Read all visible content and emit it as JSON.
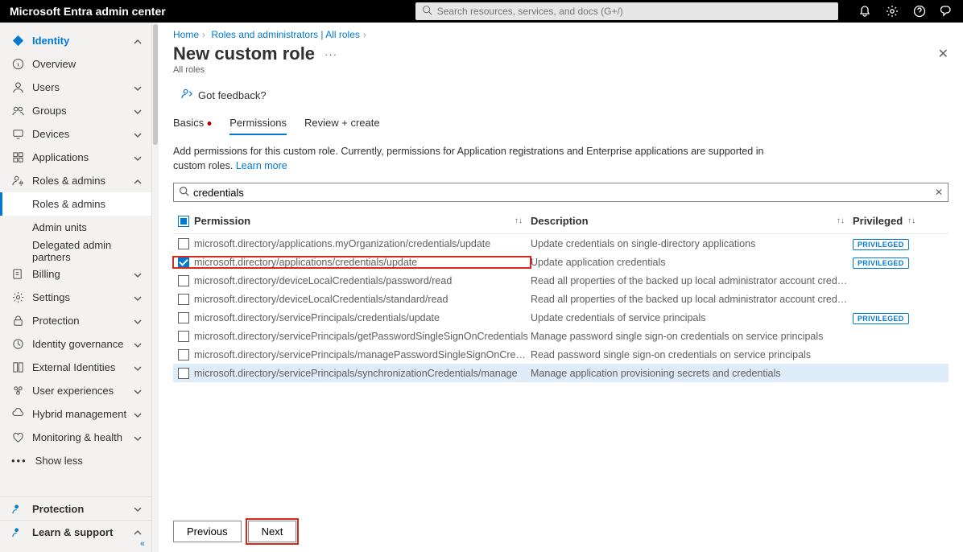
{
  "brand": "Microsoft Entra admin center",
  "search_placeholder": "Search resources, services, and docs (G+/)",
  "nav": {
    "identity": "Identity",
    "overview": "Overview",
    "users": "Users",
    "groups": "Groups",
    "devices": "Devices",
    "applications": "Applications",
    "roles_admins": "Roles & admins",
    "roles_admins_sub": "Roles & admins",
    "admin_units": "Admin units",
    "delegated": "Delegated admin partners",
    "billing": "Billing",
    "settings": "Settings",
    "protection": "Protection",
    "identity_gov": "Identity governance",
    "external": "External Identities",
    "user_exp": "User experiences",
    "hybrid": "Hybrid management",
    "monitoring": "Monitoring & health",
    "show_less": "Show less",
    "protection_section": "Protection",
    "learn": "Learn & support",
    "collapse": "«"
  },
  "breadcrumb": {
    "home": "Home",
    "mid": "Roles and administrators | All roles"
  },
  "title": "New custom role",
  "subtitle": "All roles",
  "feedback": "Got feedback?",
  "tabs": {
    "basics": "Basics",
    "permissions": "Permissions",
    "review": "Review + create"
  },
  "desc_pre": "Add permissions for this custom role. Currently, permissions for Application registrations and Enterprise applications are supported in custom roles. ",
  "desc_link": "Learn more",
  "perm_search_value": "credentials",
  "headers": {
    "permission": "Permission",
    "description": "Description",
    "privileged": "Privileged"
  },
  "badge": "PRIVILEGED",
  "rows": [
    {
      "perm": "microsoft.directory/applications.myOrganization/credentials/update",
      "desc": "Update credentials on single-directory applications",
      "priv": true,
      "checked": false,
      "highlight": false
    },
    {
      "perm": "microsoft.directory/applications/credentials/update",
      "desc": "Update application credentials",
      "priv": true,
      "checked": true,
      "highlight": true
    },
    {
      "perm": "microsoft.directory/deviceLocalCredentials/password/read",
      "desc": "Read all properties of the backed up local administrator account credentials for Microsoft Entra joi...",
      "priv": false,
      "checked": false,
      "highlight": false
    },
    {
      "perm": "microsoft.directory/deviceLocalCredentials/standard/read",
      "desc": "Read all properties of the backed up local administrator account credentials for Microsoft Entra joi...",
      "priv": false,
      "checked": false,
      "highlight": false
    },
    {
      "perm": "microsoft.directory/servicePrincipals/credentials/update",
      "desc": "Update credentials of service principals",
      "priv": true,
      "checked": false,
      "highlight": false
    },
    {
      "perm": "microsoft.directory/servicePrincipals/getPasswordSingleSignOnCredentials",
      "desc": "Manage password single sign-on credentials on service principals",
      "priv": false,
      "checked": false,
      "highlight": false
    },
    {
      "perm": "microsoft.directory/servicePrincipals/managePasswordSingleSignOnCredentials",
      "desc": "Read password single sign-on credentials on service principals",
      "priv": false,
      "checked": false,
      "highlight": false
    },
    {
      "perm": "microsoft.directory/servicePrincipals/synchronizationCredentials/manage",
      "desc": "Manage application provisioning secrets and credentials",
      "priv": false,
      "checked": false,
      "highlight": false,
      "hovered": true
    }
  ],
  "buttons": {
    "previous": "Previous",
    "next": "Next"
  }
}
